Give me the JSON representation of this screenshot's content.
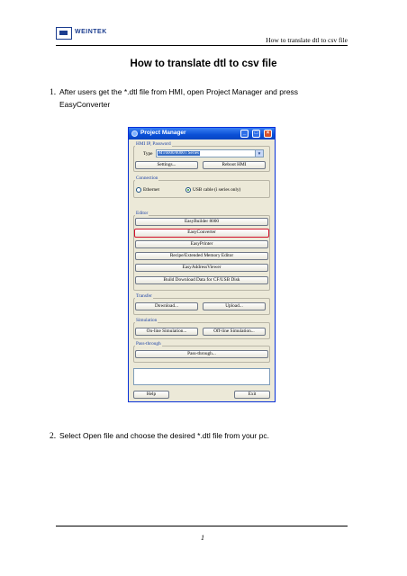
{
  "header": {
    "logo_text": "WEINTEK",
    "right_text": "How to translate dtl to csv file"
  },
  "title": "How to translate dtl to csv file",
  "steps": [
    {
      "number": "1.",
      "line1": "After users get the *.dtl file from HMI, open Project Manager and press",
      "line2": "EasyConverter"
    },
    {
      "number": "2.",
      "line1": "Select Open file and choose the desired *.dtl file from your pc."
    }
  ],
  "dialog": {
    "title": "Project Manager",
    "hmi_group": {
      "label": "HMI IP, Password",
      "type_label": "Type",
      "type_value": "MT6000/8000 i Series",
      "settings_button": "Settings...",
      "reboot_button": "Reboot HMI"
    },
    "connection_group": {
      "label": "Connection",
      "option_ethernet": "Ethernet",
      "option_usb": "USB cable (i series only)",
      "selected": "usb"
    },
    "editor_group": {
      "label": "Editor",
      "buttons": [
        "EasyBuilder 8000",
        "EasyConverter",
        "EasyPrinter",
        "Recipe/Extended Memory Editor",
        "EasyAddressViewer",
        "Build Download Data for CF/USB Disk"
      ],
      "highlighted": "EasyConverter"
    },
    "transfer_group": {
      "label": "Transfer",
      "download_button": "Download...",
      "upload_button": "Upload..."
    },
    "simulation_group": {
      "label": "Simulation",
      "online_button": "On-line Simulation...",
      "offline_button": "Off-line Simulation..."
    },
    "passthrough_group": {
      "label": "Pass-through",
      "button": "Pass-through..."
    },
    "help_button": "Help",
    "exit_button": "Exit",
    "titlebar_buttons": {
      "minimize": "_",
      "maximize": "□",
      "close": "×"
    }
  },
  "footer": {
    "page_number": "1"
  },
  "colors": {
    "titlebar": "#0a4fd6",
    "highlight": "#d2122a",
    "group_label": "#1d43a8",
    "window_bg": "#ece9d8"
  }
}
